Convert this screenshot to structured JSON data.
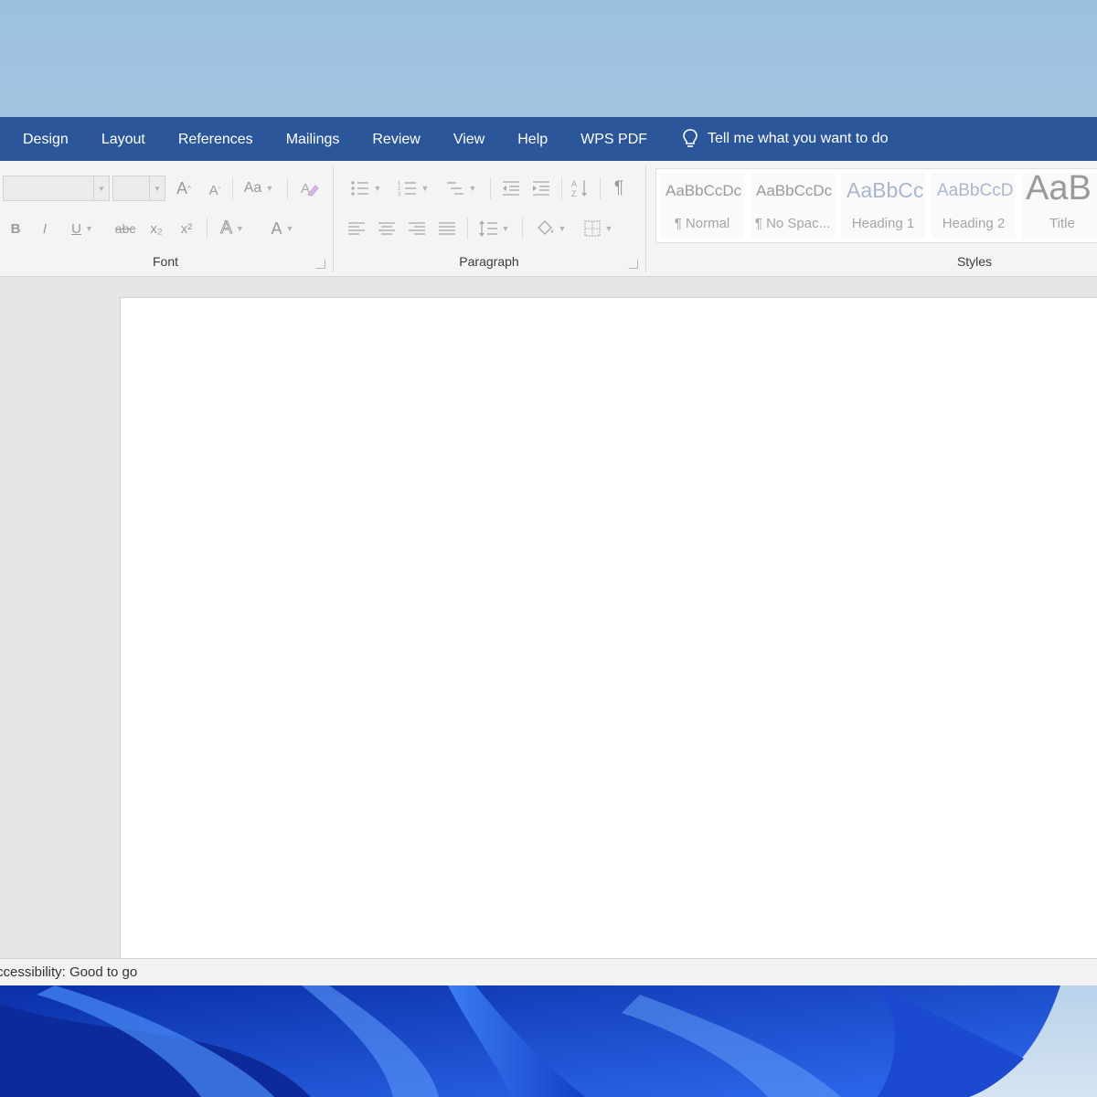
{
  "tabs": [
    "Design",
    "Layout",
    "References",
    "Mailings",
    "Review",
    "View",
    "Help",
    "WPS PDF"
  ],
  "tell_me": "Tell me what you want to do",
  "ribbon": {
    "font": {
      "label": "Font",
      "grow_label": "A",
      "shrink_label": "A",
      "case_label": "Aa",
      "bold": "B",
      "italic": "I",
      "underline": "U",
      "strike": "abc",
      "subscript": "x₂",
      "superscript": "x²",
      "text_effects": "A",
      "font_color": "A"
    },
    "paragraph": {
      "label": "Paragraph",
      "pilcrow": "¶"
    },
    "styles": {
      "label": "Styles",
      "items": [
        {
          "preview": "AaBbCcDc",
          "name": "¶ Normal"
        },
        {
          "preview": "AaBbCcDc",
          "name": "¶ No Spac..."
        },
        {
          "preview": "AaBbCc",
          "name": "Heading 1"
        },
        {
          "preview": "AaBbCcD",
          "name": "Heading 2"
        },
        {
          "preview": "AaB",
          "name": "Title"
        }
      ]
    }
  },
  "status": {
    "accessibility": "ccessibility: Good to go"
  },
  "colors": {
    "tab_bar": "#2b579a",
    "ribbon": "#f4f4f4",
    "wallpaper_bloom": "#1f5bd6"
  }
}
